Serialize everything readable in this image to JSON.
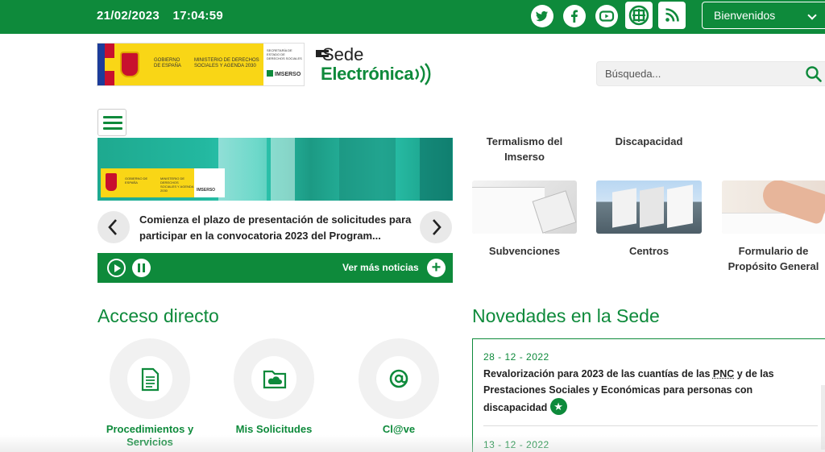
{
  "topbar": {
    "date": "21/02/2023",
    "time": "17:04:59",
    "social": [
      {
        "name": "twitter-icon"
      },
      {
        "name": "facebook-icon"
      },
      {
        "name": "youtube-icon"
      },
      {
        "name": "imserso-app-icon"
      },
      {
        "name": "rss-icon"
      }
    ],
    "welcome_label": "Bienvenidos",
    "colors": {
      "primary": "#0e8a3b",
      "text_on_primary": "#ffffff"
    }
  },
  "header": {
    "gov_logo": {
      "gobierno": "GOBIERNO DE ESPAÑA",
      "ministerio": "MINISTERIO DE DERECHOS SOCIALES Y AGENDA 2030",
      "secretaria": "SECRETARÍA DE ESTADO DE DERECHOS SOCIALES",
      "imserso": "IMSERSO"
    },
    "sede_logo": {
      "line1": "Sede",
      "line2": "Electrónica"
    },
    "search": {
      "placeholder": "Búsqueda..."
    }
  },
  "carousel": {
    "banner": {
      "gobierno": "GOBIERNO DE ESPAÑA",
      "ministerio": "MINISTERIO DE DERECHOS SOCIALES Y AGENDA 2030",
      "imserso": "IMSERSO"
    },
    "news_text": "Comienza el plazo de presentación de solicitudes para participar en la convocatoria 2023 del Program...",
    "more_news": "Ver más noticias",
    "plus": "+"
  },
  "tiles": [
    {
      "title": "Termalismo del Imserso"
    },
    {
      "title": "Discapacidad"
    },
    {
      "title": "Subvenciones"
    },
    {
      "title": "Centros"
    },
    {
      "title": "Formulario de Propósito General"
    }
  ],
  "acceso_directo": {
    "title": "Acceso directo",
    "items": [
      {
        "label": "Procedimientos y Servicios",
        "icon": "document-icon"
      },
      {
        "label": "Mis Solicitudes",
        "icon": "folder-cloud-icon"
      },
      {
        "label": "Cl@ve",
        "icon": "clave-icon"
      }
    ]
  },
  "novedades": {
    "title": "Novedades en la Sede",
    "items": [
      {
        "date": "28 - 12 - 2022",
        "text_before": "Revalorización para 2023 de las cuantías de las ",
        "abbr": "PNC",
        "text_after": " y de las Prestaciones Sociales y Económicas para personas con discapacidad"
      },
      {
        "date": "13 - 12 - 2022"
      }
    ]
  }
}
